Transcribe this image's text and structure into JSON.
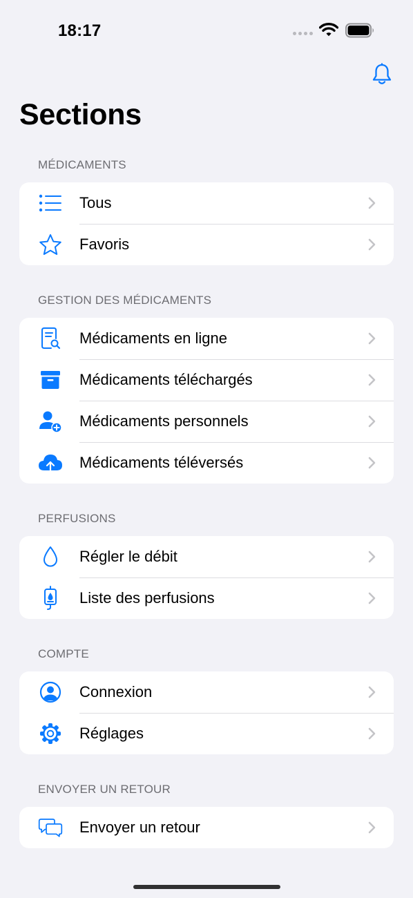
{
  "status_bar": {
    "time": "18:17"
  },
  "page": {
    "title": "Sections"
  },
  "sections": [
    {
      "header": "MÉDICAMENTS",
      "items": [
        {
          "label": "Tous",
          "icon": "list-icon"
        },
        {
          "label": "Favoris",
          "icon": "star-icon"
        }
      ]
    },
    {
      "header": "GESTION DES MÉDICAMENTS",
      "items": [
        {
          "label": "Médicaments en ligne",
          "icon": "document-search-icon"
        },
        {
          "label": "Médicaments téléchargés",
          "icon": "archive-box-icon"
        },
        {
          "label": "Médicaments personnels",
          "icon": "person-add-icon"
        },
        {
          "label": "Médicaments téléversés",
          "icon": "cloud-upload-icon"
        }
      ]
    },
    {
      "header": "PERFUSIONS",
      "items": [
        {
          "label": "Régler le débit",
          "icon": "drop-icon"
        },
        {
          "label": "Liste des perfusions",
          "icon": "iv-bag-icon"
        }
      ]
    },
    {
      "header": "COMPTE",
      "items": [
        {
          "label": "Connexion",
          "icon": "person-circle-icon"
        },
        {
          "label": "Réglages",
          "icon": "gear-icon"
        }
      ]
    },
    {
      "header": "ENVOYER UN RETOUR",
      "items": [
        {
          "label": "Envoyer un retour",
          "icon": "chat-bubbles-icon"
        }
      ]
    }
  ],
  "colors": {
    "accent": "#0a7aff",
    "background": "#f2f2f7",
    "card": "#ffffff",
    "secondary_text": "#6d6d72",
    "separator": "#dcdce0",
    "chevron": "#c4c4c7"
  }
}
